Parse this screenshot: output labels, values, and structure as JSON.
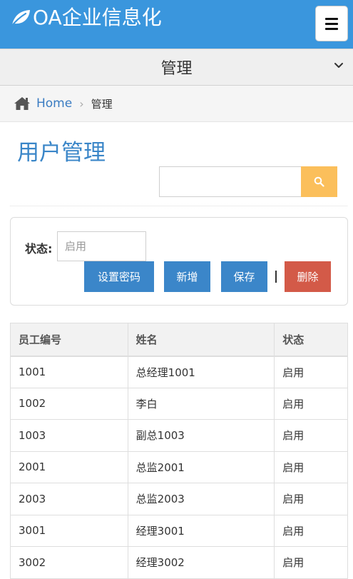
{
  "header": {
    "brand": "OA企业信息化",
    "menu_icon": "hamburger-icon",
    "accent_color": "#3a96dd"
  },
  "section": {
    "title": "管理",
    "chevron_icon": "chevron-down-icon"
  },
  "breadcrumb": {
    "home_icon": "home-icon",
    "home": "Home",
    "separator": "›",
    "current": "管理"
  },
  "page": {
    "title": "用户管理"
  },
  "search": {
    "value": "",
    "placeholder": "",
    "icon": "search-icon",
    "button_color": "#fbbf5b"
  },
  "form": {
    "status_label": "状态:",
    "status_placeholder": "启用",
    "buttons": {
      "set_password": "设置密码",
      "add": "新增",
      "save": "保存",
      "delete": "删除"
    },
    "divider": "|"
  },
  "table": {
    "headers": [
      "员工编号",
      "姓名",
      "状态"
    ],
    "rows": [
      [
        "1001",
        "总经理1001",
        "启用"
      ],
      [
        "1002",
        "李白",
        "启用"
      ],
      [
        "1003",
        "副总1003",
        "启用"
      ],
      [
        "2001",
        "总监2001",
        "启用"
      ],
      [
        "2003",
        "总监2003",
        "启用"
      ],
      [
        "3001",
        "经理3001",
        "启用"
      ],
      [
        "3002",
        "经理3002",
        "启用"
      ]
    ]
  }
}
